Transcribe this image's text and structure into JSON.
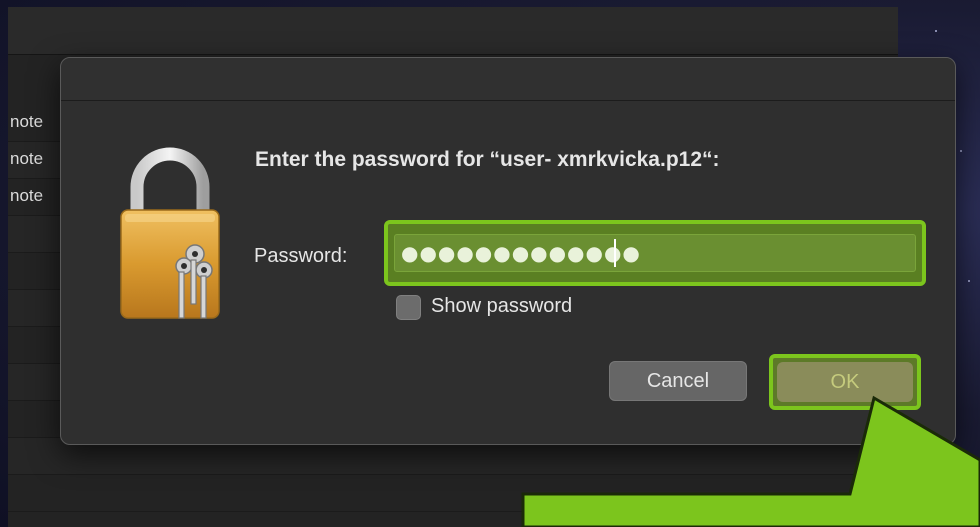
{
  "app": {
    "rows": [
      {
        "label": "note"
      },
      {
        "label": "note"
      },
      {
        "label": "note"
      },
      {
        "label": ""
      },
      {
        "label": ""
      },
      {
        "label": ""
      },
      {
        "label": ""
      },
      {
        "label": ""
      },
      {
        "label": ""
      },
      {
        "label": ""
      }
    ]
  },
  "dialog": {
    "prompt": "Enter the password for “user- xmrkvicka.p12“:",
    "password_label": "Password:",
    "password_value": "●●●●●●●●●●●●●",
    "show_password_label": "Show password",
    "show_password_checked": false,
    "cancel_label": "Cancel",
    "ok_label": "OK",
    "icon": "lock-with-keys-icon"
  },
  "annotation": {
    "highlight_color": "#7cc51d",
    "callout_color": "#7cc51d"
  }
}
